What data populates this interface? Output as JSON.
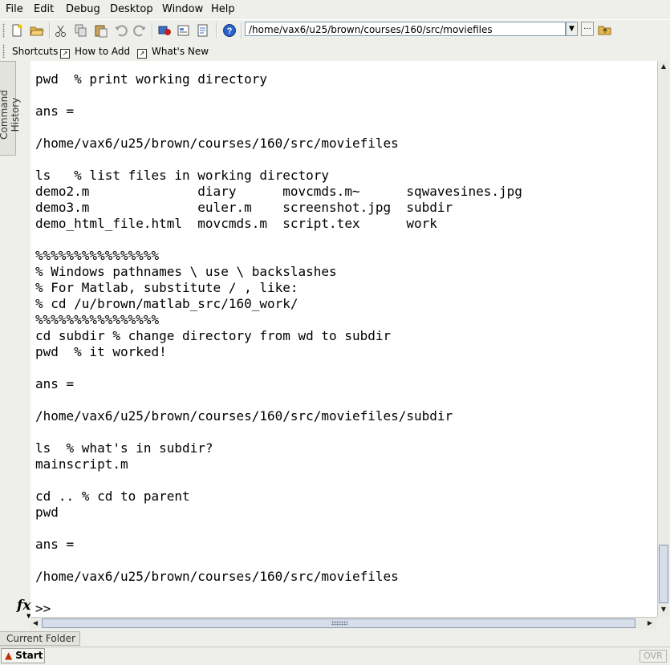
{
  "menu": {
    "items": [
      "File",
      "Edit",
      "Debug",
      "Desktop",
      "Window",
      "Help"
    ]
  },
  "toolbar": {
    "current_path": "/home/vax6/u25/brown/courses/160/src/moviefiles",
    "browse_label": "..."
  },
  "shortcuts": {
    "items": [
      "Shortcuts",
      "How to Add",
      "What's New"
    ]
  },
  "sidebar": {
    "command_history_tab": "Command History"
  },
  "command_window": {
    "lines": [
      "pwd  % print working directory",
      "",
      "ans =",
      "",
      "/home/vax6/u25/brown/courses/160/src/moviefiles",
      "",
      "ls   % list files in working directory",
      "demo2.m              diary      movcmds.m~      sqwavesines.jpg",
      "demo3.m              euler.m    screenshot.jpg  subdir",
      "demo_html_file.html  movcmds.m  script.tex      work",
      "",
      "%%%%%%%%%%%%%%%%",
      "% Windows pathnames \\ use \\ backslashes",
      "% For Matlab, substitute / , like:",
      "% cd /u/brown/matlab_src/160_work/",
      "%%%%%%%%%%%%%%%%",
      "cd subdir % change directory from wd to subdir",
      "pwd  % it worked!",
      "",
      "ans =",
      "",
      "/home/vax6/u25/brown/courses/160/src/moviefiles/subdir",
      "",
      "ls  % what's in subdir?",
      "mainscript.m",
      "",
      "cd .. % cd to parent",
      "pwd",
      "",
      "ans =",
      "",
      "/home/vax6/u25/brown/courses/160/src/moviefiles",
      "",
      ""
    ],
    "prompt": ">>",
    "fx_label": "fx"
  },
  "bottom": {
    "current_folder_tab": "Current Folder",
    "start_label": "Start",
    "ovr_label": "OVR"
  },
  "colors": {
    "background": "#eeeeea",
    "scroll_thumb": "#d7dde9",
    "matlab_logo": "#c03000"
  }
}
